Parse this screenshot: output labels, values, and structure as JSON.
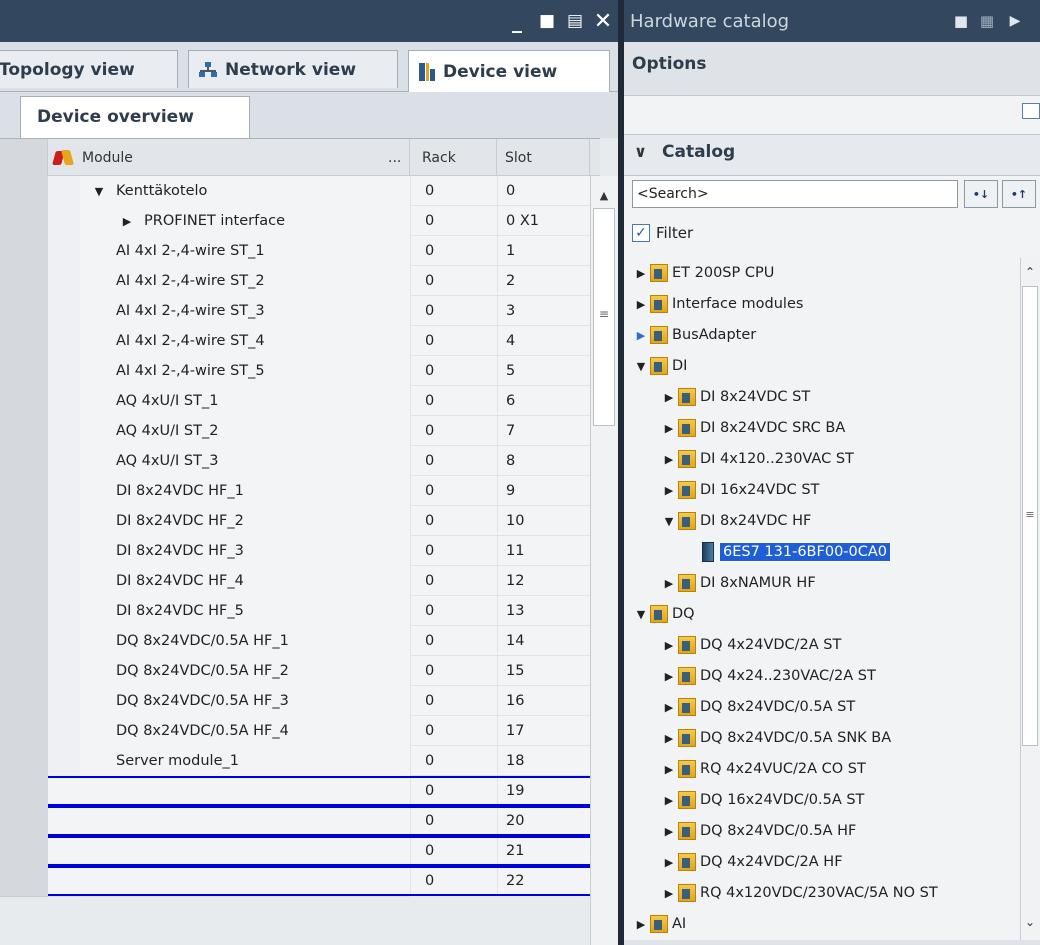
{
  "left_window": {
    "tabs": [
      "Topology view",
      "Network view",
      "Device view"
    ],
    "subtab": "Device overview",
    "columns": {
      "module": "Module",
      "more": "...",
      "rack": "Rack",
      "slot": "Slot"
    },
    "rows": [
      {
        "module": "Kenttäkotelo",
        "rack": "0",
        "slot": "0",
        "indent": 1,
        "expander": "down"
      },
      {
        "module": "PROFINET interface",
        "rack": "0",
        "slot": "0 X1",
        "indent": 2,
        "expander": "right"
      },
      {
        "module": "AI 4xI 2-,4-wire ST_1",
        "rack": "0",
        "slot": "1",
        "indent": 1
      },
      {
        "module": "AI 4xI 2-,4-wire ST_2",
        "rack": "0",
        "slot": "2",
        "indent": 1
      },
      {
        "module": "AI 4xI 2-,4-wire ST_3",
        "rack": "0",
        "slot": "3",
        "indent": 1
      },
      {
        "module": "AI 4xI 2-,4-wire ST_4",
        "rack": "0",
        "slot": "4",
        "indent": 1
      },
      {
        "module": "AI 4xI 2-,4-wire ST_5",
        "rack": "0",
        "slot": "5",
        "indent": 1
      },
      {
        "module": "AQ 4xU/I ST_1",
        "rack": "0",
        "slot": "6",
        "indent": 1
      },
      {
        "module": "AQ 4xU/I ST_2",
        "rack": "0",
        "slot": "7",
        "indent": 1
      },
      {
        "module": "AQ 4xU/I ST_3",
        "rack": "0",
        "slot": "8",
        "indent": 1
      },
      {
        "module": "DI 8x24VDC HF_1",
        "rack": "0",
        "slot": "9",
        "indent": 1
      },
      {
        "module": "DI 8x24VDC HF_2",
        "rack": "0",
        "slot": "10",
        "indent": 1
      },
      {
        "module": "DI 8x24VDC HF_3",
        "rack": "0",
        "slot": "11",
        "indent": 1
      },
      {
        "module": "DI 8x24VDC HF_4",
        "rack": "0",
        "slot": "12",
        "indent": 1
      },
      {
        "module": "DI 8x24VDC HF_5",
        "rack": "0",
        "slot": "13",
        "indent": 1
      },
      {
        "module": "DQ 8x24VDC/0.5A HF_1",
        "rack": "0",
        "slot": "14",
        "indent": 1
      },
      {
        "module": "DQ 8x24VDC/0.5A HF_2",
        "rack": "0",
        "slot": "15",
        "indent": 1
      },
      {
        "module": "DQ 8x24VDC/0.5A HF_3",
        "rack": "0",
        "slot": "16",
        "indent": 1
      },
      {
        "module": "DQ 8x24VDC/0.5A HF_4",
        "rack": "0",
        "slot": "17",
        "indent": 1
      },
      {
        "module": "Server module_1",
        "rack": "0",
        "slot": "18",
        "indent": 1
      },
      {
        "module": "",
        "rack": "0",
        "slot": "19",
        "indent": 1,
        "empty": true
      },
      {
        "module": "",
        "rack": "0",
        "slot": "20",
        "indent": 1,
        "empty": true
      },
      {
        "module": "",
        "rack": "0",
        "slot": "21",
        "indent": 1,
        "empty": true
      },
      {
        "module": "",
        "rack": "0",
        "slot": "22",
        "indent": 1,
        "empty": true
      }
    ]
  },
  "catalog": {
    "title": "Hardware catalog",
    "options_label": "Options",
    "catalog_label": "Catalog",
    "search_value": "<Search>",
    "filter_label": "Filter",
    "filter_checked": true,
    "tree": [
      {
        "label": "ET 200SP CPU",
        "level": 0,
        "expander": "right",
        "icon": "folder"
      },
      {
        "label": "Interface modules",
        "level": 0,
        "expander": "right",
        "icon": "folder"
      },
      {
        "label": "BusAdapter",
        "level": 0,
        "expander": "right-blue",
        "icon": "folder"
      },
      {
        "label": "DI",
        "level": 0,
        "expander": "down",
        "icon": "folder"
      },
      {
        "label": "DI 8x24VDC ST",
        "level": 1,
        "expander": "right",
        "icon": "folder"
      },
      {
        "label": "DI 8x24VDC SRC BA",
        "level": 1,
        "expander": "right",
        "icon": "folder"
      },
      {
        "label": "DI 4x120..230VAC ST",
        "level": 1,
        "expander": "right",
        "icon": "folder"
      },
      {
        "label": "DI 16x24VDC ST",
        "level": 1,
        "expander": "right",
        "icon": "folder"
      },
      {
        "label": "DI 8x24VDC HF",
        "level": 1,
        "expander": "down",
        "icon": "folder"
      },
      {
        "label": "6ES7 131-6BF00-0CA0",
        "level": 2,
        "expander": "",
        "icon": "module",
        "selected": true
      },
      {
        "label": "DI 8xNAMUR HF",
        "level": 1,
        "expander": "right",
        "icon": "folder"
      },
      {
        "label": "DQ",
        "level": 0,
        "expander": "down",
        "icon": "folder"
      },
      {
        "label": "DQ 4x24VDC/2A ST",
        "level": 1,
        "expander": "right",
        "icon": "folder"
      },
      {
        "label": "DQ 4x24..230VAC/2A ST",
        "level": 1,
        "expander": "right",
        "icon": "folder"
      },
      {
        "label": "DQ 8x24VDC/0.5A ST",
        "level": 1,
        "expander": "right",
        "icon": "folder"
      },
      {
        "label": "DQ 8x24VDC/0.5A SNK BA",
        "level": 1,
        "expander": "right",
        "icon": "folder"
      },
      {
        "label": "RQ 4x24VUC/2A CO ST",
        "level": 1,
        "expander": "right",
        "icon": "folder"
      },
      {
        "label": "DQ 16x24VDC/0.5A ST",
        "level": 1,
        "expander": "right",
        "icon": "folder"
      },
      {
        "label": "DQ 8x24VDC/0.5A HF",
        "level": 1,
        "expander": "right",
        "icon": "folder"
      },
      {
        "label": "DQ 4x24VDC/2A HF",
        "level": 1,
        "expander": "right",
        "icon": "folder"
      },
      {
        "label": "RQ 4x120VDC/230VAC/5A NO ST",
        "level": 1,
        "expander": "right",
        "icon": "folder"
      },
      {
        "label": "AI",
        "level": 0,
        "expander": "right",
        "icon": "folder"
      }
    ]
  },
  "colors": {
    "titlebar": "#33485e",
    "selection": "#1f5fd6",
    "empty_row_marker": "#0000d8"
  }
}
